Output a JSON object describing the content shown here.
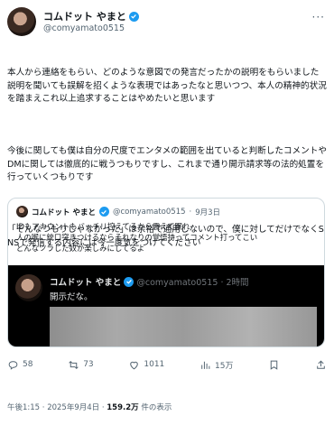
{
  "author": {
    "name": "コムドット やまと",
    "handle": "@comyamato0515"
  },
  "body": {
    "paragraphs": [
      "本人から連絡をもらい、どのような意図での発言だったかの説明をもらいました\n説明を聞いても誤解を招くような表現ではあったなと思いつつ、本人の精神的状況を踏まえこれ以上追求することはやめたいと思います",
      "今後に関しても僕は自分の尺度でエンタメの範囲を出ていると判断したコメントやDMに関しては徹底的に戦うつもりですし、これまで通り開示請求等の法的処置を行っていくつもりです",
      "「そんなつもりじゃなかった」は余裕で通用しないので、僕に対してだけでなくSNSで発信する内容には今一度気をつけてください"
    ]
  },
  "quote": {
    "name": "コムドット やまと",
    "handle": "@comyamato0515",
    "date": "9月3日",
    "lines": [
      "IDもアカウントもバッチリ控えてるから震えて眠れ",
      "人の喉に銃口突きつけるならそれなりの覚悟持ってコメント打ってこい",
      "どんなツラした奴か楽しみにしてるよ"
    ],
    "media": {
      "name": "コムドット やまと",
      "handle": "@comyamato0515",
      "time": "2時間",
      "text": "開示だな。"
    }
  },
  "actions": {
    "replies": "58",
    "retweets": "73",
    "likes": "1011",
    "views": "15万"
  },
  "footer": {
    "time": "午後1:15",
    "date": "2025年9月4日",
    "views": "159.2万",
    "views_label": "件の表示"
  },
  "colors": {
    "verified": "#1d9bf0",
    "text": "#0f1419",
    "muted": "#536471"
  }
}
